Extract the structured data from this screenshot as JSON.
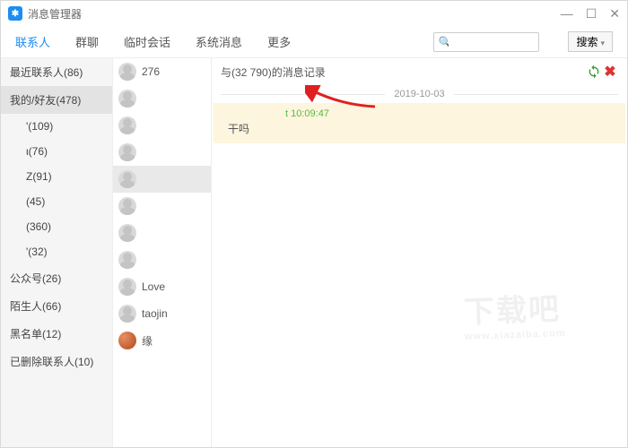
{
  "window": {
    "title": "消息管理器"
  },
  "tabs": [
    "联系人",
    "群聊",
    "临时会话",
    "系统消息",
    "更多"
  ],
  "activeTab": 0,
  "search": {
    "placeholder": "",
    "button": "搜索"
  },
  "categories": [
    {
      "label": "最近联系人(86)",
      "indent": false,
      "active": false
    },
    {
      "label": "我的/好友(478)",
      "indent": false,
      "active": true
    },
    {
      "label": "'(109)",
      "indent": true,
      "active": false
    },
    {
      "label": "ι(76)",
      "indent": true,
      "active": false
    },
    {
      "label": "Z(91)",
      "indent": true,
      "active": false
    },
    {
      "label": "(45)",
      "indent": true,
      "active": false
    },
    {
      "label": "(360)",
      "indent": true,
      "active": false
    },
    {
      "label": "'(32)",
      "indent": true,
      "active": false
    },
    {
      "label": "公众号(26)",
      "indent": false,
      "active": false
    },
    {
      "label": "陌生人(66)",
      "indent": false,
      "active": false
    },
    {
      "label": "黑名单(12)",
      "indent": false,
      "active": false
    },
    {
      "label": "已删除联系人(10)",
      "indent": false,
      "active": false
    }
  ],
  "contacts": [
    {
      "name": "276",
      "color": false,
      "selected": false
    },
    {
      "name": "",
      "color": false,
      "selected": false
    },
    {
      "name": "",
      "color": false,
      "selected": false
    },
    {
      "name": "",
      "color": false,
      "selected": false
    },
    {
      "name": "",
      "color": false,
      "selected": true
    },
    {
      "name": "",
      "color": false,
      "selected": false
    },
    {
      "name": "",
      "color": false,
      "selected": false
    },
    {
      "name": "",
      "color": false,
      "selected": false
    },
    {
      "name": "Love",
      "color": false,
      "selected": false
    },
    {
      "name": "taojin",
      "color": false,
      "selected": false
    },
    {
      "name": "缘",
      "color": true,
      "selected": false
    }
  ],
  "chat": {
    "title": "与(32         790)的消息记录",
    "date": "2019-10-03",
    "messages": [
      {
        "meta": "t 10:09:47",
        "text": "干吗"
      }
    ]
  },
  "watermark": {
    "main": "下载吧",
    "sub": "www.xiazaiba.com"
  }
}
